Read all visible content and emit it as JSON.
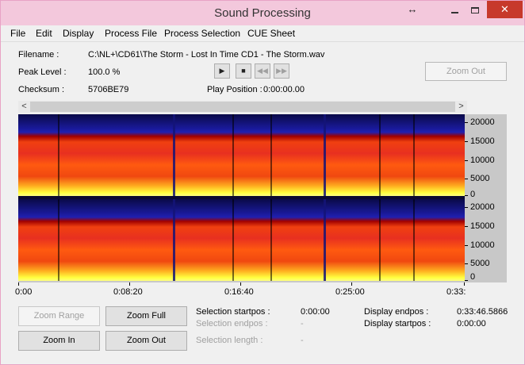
{
  "window": {
    "title": "Sound Processing"
  },
  "titlebar": {
    "resize_icon": "↔",
    "minimize_icon": "minimize",
    "maximize_icon": "maximize",
    "close_icon": "✕"
  },
  "menu": [
    "File",
    "Edit",
    "Display",
    "Process File",
    "Process Selection",
    "CUE Sheet"
  ],
  "info": {
    "filename_label": "Filename :",
    "filename_value": "C:\\NL+\\CD61\\The Storm - Lost In Time CD1 - The Storm.wav",
    "peak_label": "Peak Level :",
    "peak_value": "100.0 %",
    "checksum_label": "Checksum :",
    "checksum_value": "5706BE79",
    "play_position_label": "Play Position :",
    "play_position_value": "0:00:00.00"
  },
  "transport": {
    "play": "▶",
    "stop": "■",
    "rewind": "◀◀",
    "forward": "▶▶"
  },
  "zoom_out_top": "Zoom Out",
  "scrollbar": {
    "left_arrow": "<",
    "right_arrow": ">"
  },
  "spectrogram": {
    "y_ticks": [
      "20000",
      "15000",
      "10000",
      "5000",
      "0"
    ],
    "x_ticks": [
      "0:00",
      "0:08:20",
      "0:16:40",
      "0:25:00",
      "0:33:"
    ]
  },
  "buttons": {
    "zoom_range": "Zoom Range",
    "zoom_full": "Zoom Full",
    "zoom_in": "Zoom In",
    "zoom_out": "Zoom Out"
  },
  "selection": {
    "startpos_label": "Selection startpos :",
    "startpos_value": "0:00:00",
    "endpos_label": "Selection endpos :",
    "endpos_value": "-",
    "length_label": "Selection length :",
    "length_value": "-",
    "display_endpos_label": "Display endpos :",
    "display_endpos_value": "0:33:46.5866",
    "display_startpos_label": "Display startpos :",
    "display_startpos_value": "0:00:00"
  }
}
